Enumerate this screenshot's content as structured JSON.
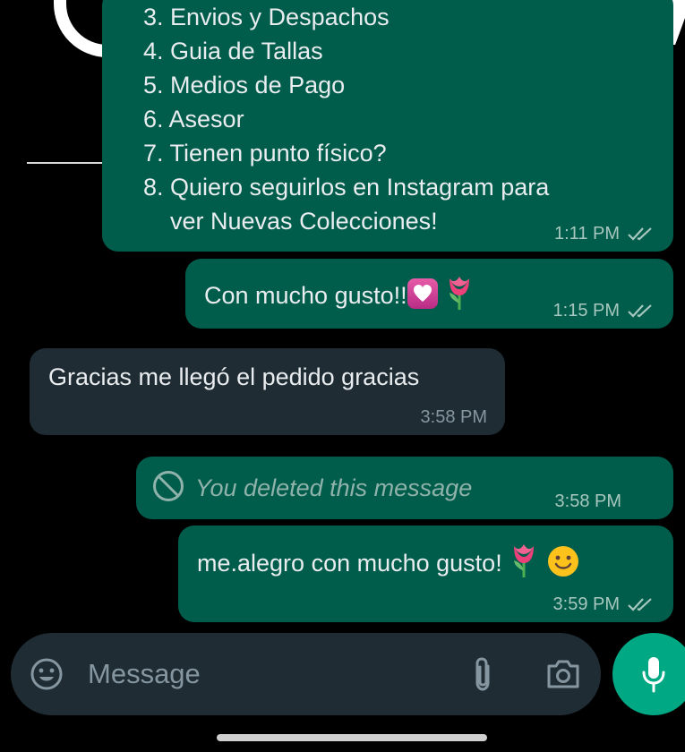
{
  "messages": {
    "menu": {
      "items": [
        "3. Envios y Despachos",
        "4. Guia de Tallas",
        "5. Medios de Pago",
        "6. Asesor",
        "7. Tienen punto físico?",
        "8. Quiero seguirlos en Instagram para",
        "    ver Nuevas Colecciones!"
      ],
      "time": "1:11 PM"
    },
    "reply1": {
      "text": "Con mucho gusto!!",
      "time": "1:15 PM"
    },
    "incoming": {
      "text": "Gracias me llegó el pedido gracias",
      "time": "3:58 PM"
    },
    "deleted": {
      "text": "You deleted this message",
      "time": "3:58 PM"
    },
    "reply2": {
      "text": "me.alegro con mucho gusto!",
      "time": "3:59 PM"
    }
  },
  "input": {
    "placeholder": "Message"
  },
  "colors": {
    "outgoing_bubble": "#005c4b",
    "incoming_bubble": "#1f2c34",
    "accent": "#00a884",
    "read_ticks": "#a7c7bf"
  }
}
